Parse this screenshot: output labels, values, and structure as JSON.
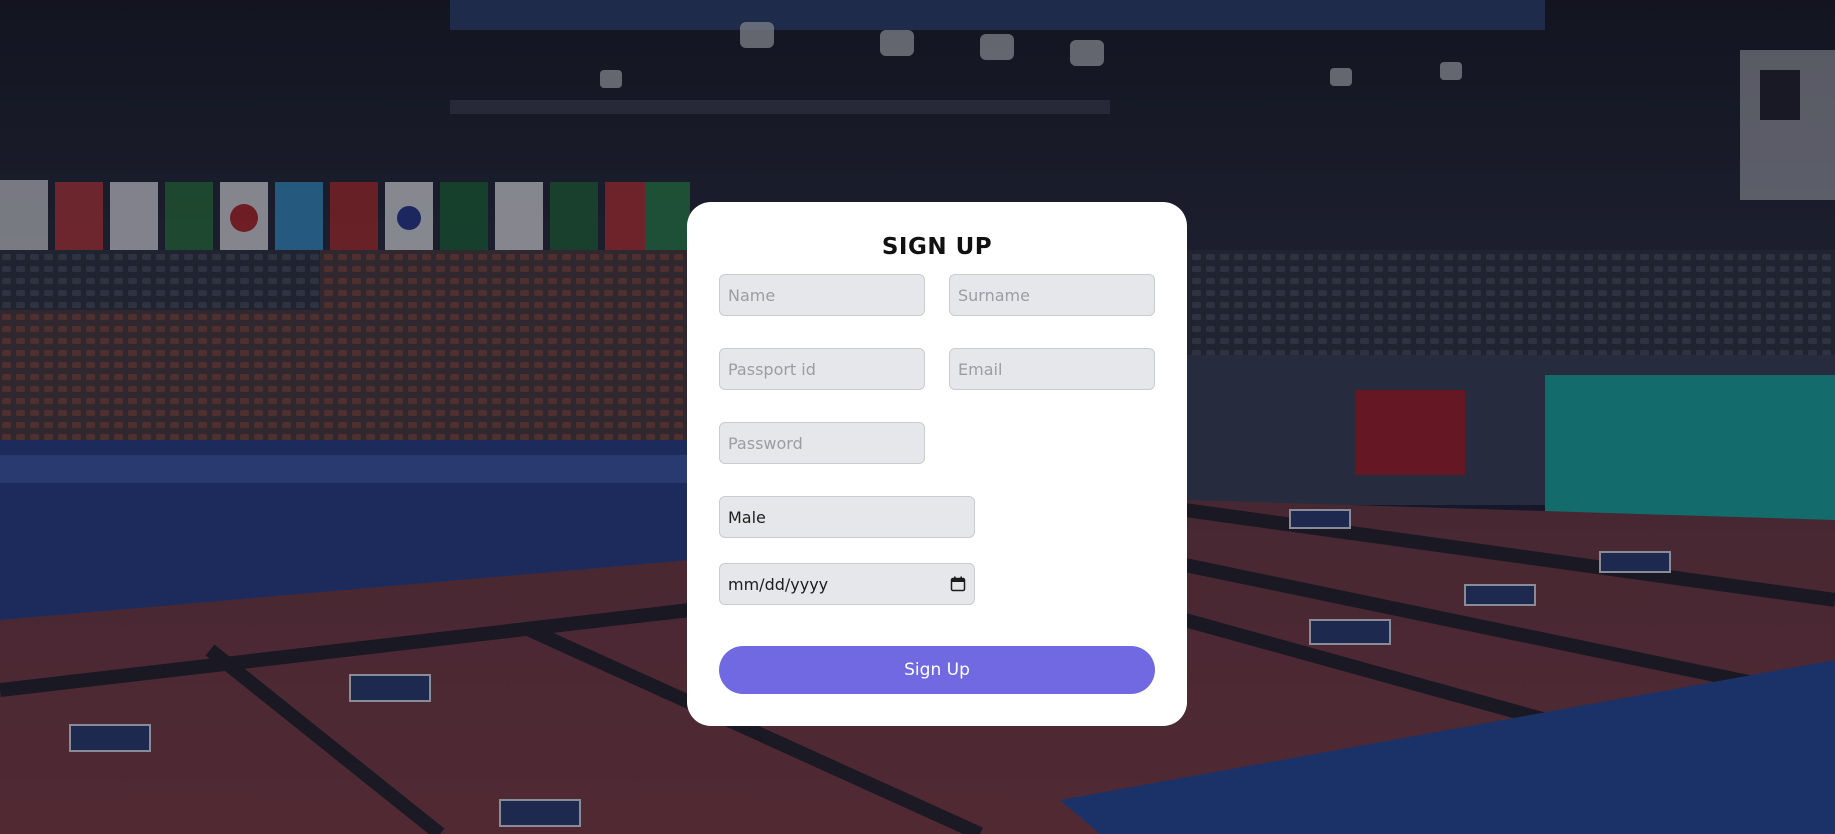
{
  "signup": {
    "title": "SIGN UP",
    "name_placeholder": "Name",
    "surname_placeholder": "Surname",
    "passport_placeholder": "Passport id",
    "email_placeholder": "Email",
    "password_placeholder": "Password",
    "gender_value": "Male",
    "date_placeholder": "mm/dd/yyyy",
    "submit_label": "Sign Up"
  },
  "icons": {
    "date_picker": "calendar-icon"
  },
  "colors": {
    "card_background": "#ffffff",
    "input_background": "#e6e7ea",
    "submit_button": "#7069e2",
    "title_text": "#111111"
  }
}
